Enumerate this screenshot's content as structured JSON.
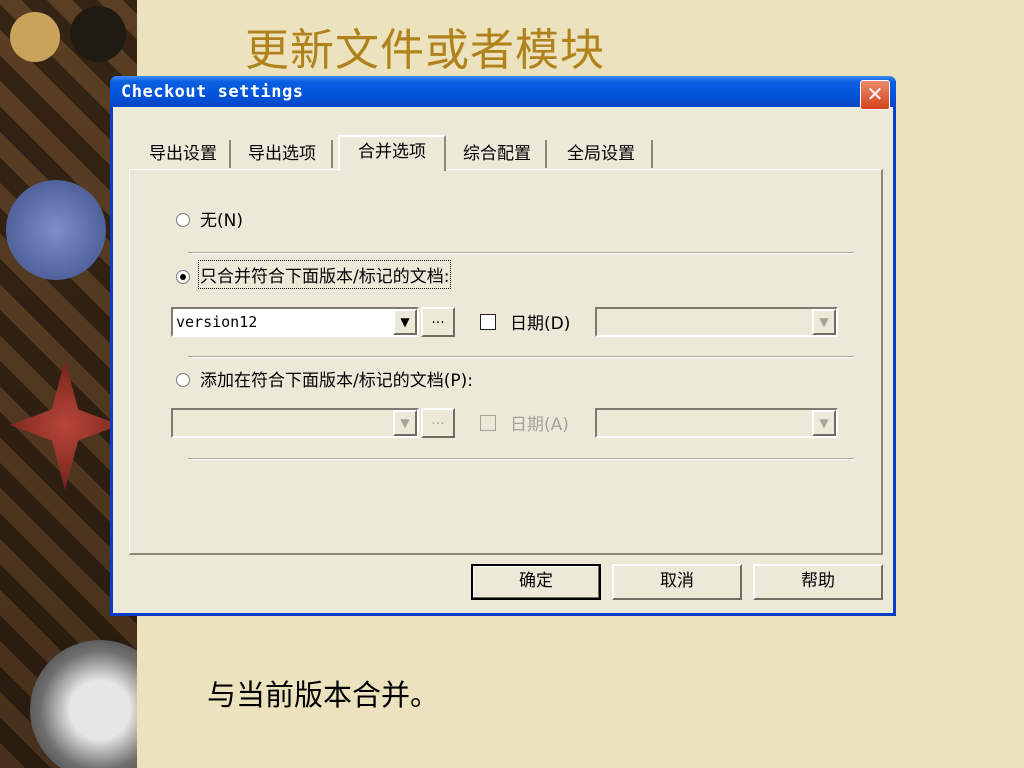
{
  "slide": {
    "title": "更新文件或者模块",
    "caption": "与当前版本合并。"
  },
  "dialog": {
    "title": "Checkout settings",
    "close_icon": "close-icon",
    "tabs": [
      {
        "label": "导出设置",
        "active": false
      },
      {
        "label": "导出选项",
        "active": false
      },
      {
        "label": "合并选项",
        "active": true
      },
      {
        "label": "综合配置",
        "active": false
      },
      {
        "label": "全局设置",
        "active": false
      }
    ],
    "options": {
      "none": {
        "label": "无(N)",
        "selected": false
      },
      "merge_only": {
        "label": "只合并符合下面版本/标记的文档:",
        "selected": true
      },
      "version_value": "version12",
      "ellipsis": "...",
      "date1_label": "日期(D)",
      "add_label": "添加在符合下面版本/标记的文档(P):",
      "date2_label": "日期(A)"
    },
    "buttons": {
      "ok": "确定",
      "cancel": "取消",
      "help": "帮助"
    }
  },
  "colors": {
    "title_gold": "#b0821c",
    "xp_blue": "#0356dd",
    "dialog_bg": "#ece9d8",
    "close_red": "#d3421c"
  }
}
